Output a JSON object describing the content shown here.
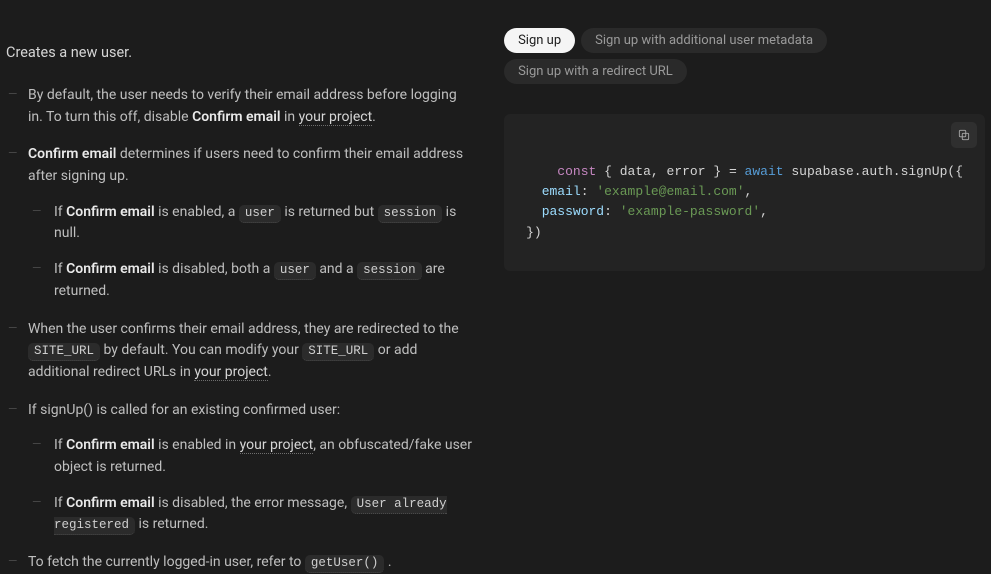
{
  "description": "Creates a new user.",
  "bullets": {
    "b1_pre": "By default, the user needs to verify their email address before logging in. To turn this off, disable ",
    "b1_strong": "Confirm email",
    "b1_in": " in ",
    "b1_link": "your project",
    "b1_end": ".",
    "b2_strong": "Confirm email",
    "b2_post": " determines if users need to confirm their email address after signing up.",
    "b2a_pre": "If ",
    "b2a_strong": "Confirm email",
    "b2a_mid": " is enabled, a ",
    "b2a_code1": "user",
    "b2a_mid2": " is returned but ",
    "b2a_code2": "session",
    "b2a_end": " is null.",
    "b2b_pre": "If ",
    "b2b_strong": "Confirm email",
    "b2b_mid": " is disabled, both a ",
    "b2b_code1": "user",
    "b2b_mid2": " and a ",
    "b2b_code2": "session",
    "b2b_end": " are returned.",
    "b3_pre": "When the user confirms their email address, they are redirected to the ",
    "b3_code1": "SITE_URL",
    "b3_mid": " by default. You can modify your ",
    "b3_code2": "SITE_URL",
    "b3_mid2": " or add additional redirect URLs in ",
    "b3_link": "your project",
    "b3_end": ".",
    "b4": "If signUp() is called for an existing confirmed user:",
    "b4a_pre": "If ",
    "b4a_strong": "Confirm email",
    "b4a_mid": " is enabled in ",
    "b4a_link": "your project",
    "b4a_end": ", an obfuscated/fake user object is returned.",
    "b4b_pre": "If ",
    "b4b_strong": "Confirm email",
    "b4b_mid": " is disabled, the error message, ",
    "b4b_code": "User already registered",
    "b4b_end": " is returned.",
    "b5_pre": "To fetch the currently logged-in user, refer to ",
    "b5_code": "getUser()",
    "b5_end": " ."
  },
  "tabs": {
    "t0": "Sign up",
    "t1": "Sign up with additional user metadata",
    "t2": "Sign up with a redirect URL"
  },
  "code": {
    "const": "const",
    "destruct": " { data, error } ",
    "eq": "= ",
    "await": "await",
    "call": " supabase.auth.signUp({",
    "emailKey": "email",
    "colon": ": ",
    "emailVal": "'example@email.com'",
    "comma": ",",
    "passKey": "password",
    "passVal": "'example-password'",
    "close": "})"
  }
}
